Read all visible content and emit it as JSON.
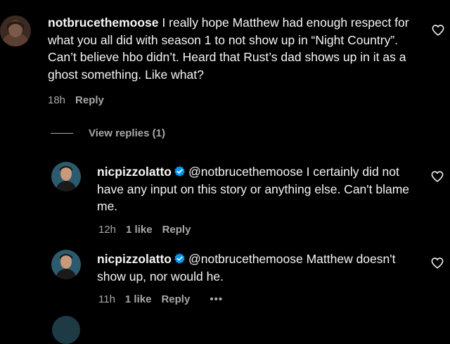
{
  "comments": [
    {
      "username": "notbrucethemoose",
      "text": "I really hope Matthew had enough respect for what you all did with season 1 to not show up in “Night Country”. Can’t believe hbo didn’t. Heard that Rust’s dad shows up in it as a ghost something. Like what?",
      "time": "18h",
      "reply_label": "Reply"
    }
  ],
  "view_replies_label": "View replies (1)",
  "replies": [
    {
      "username": "nicpizzolatto",
      "mention": "@notbrucethemoose",
      "text": "I certainly did not have any input on this story or anything else. Can't blame me.",
      "time": "12h",
      "likes": "1 like",
      "reply_label": "Reply"
    },
    {
      "username": "nicpizzolatto",
      "mention": "@notbrucethemoose",
      "text": "Matthew doesn't show up, nor would he.",
      "time": "11h",
      "likes": "1 like",
      "reply_label": "Reply",
      "more_label": "•••"
    }
  ],
  "icons": {
    "like": "heart-outline-icon",
    "verified": "verified-badge-icon",
    "more": "more-options-icon"
  },
  "colors": {
    "background": "#000000",
    "text": "#f5f5f5",
    "secondary": "#a8a8a8",
    "verified": "#0095f6"
  }
}
